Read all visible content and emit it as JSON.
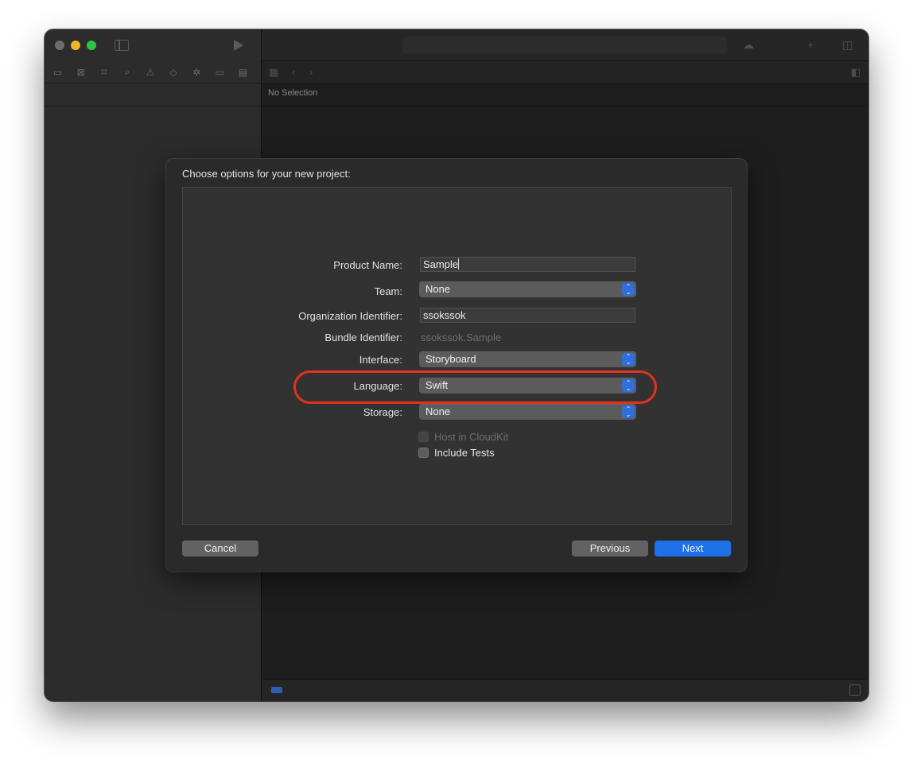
{
  "window": {
    "main": {
      "no_selection": "No Selection"
    }
  },
  "dialog": {
    "title": "Choose options for your new project:",
    "fields": {
      "product_name": {
        "label": "Product Name:",
        "value": "Sample"
      },
      "team": {
        "label": "Team:",
        "value": "None"
      },
      "organization_identifier": {
        "label": "Organization Identifier:",
        "value": "ssokssok"
      },
      "bundle_identifier": {
        "label": "Bundle Identifier:",
        "value": "ssokssok.Sample"
      },
      "interface": {
        "label": "Interface:",
        "value": "Storyboard"
      },
      "language": {
        "label": "Language:",
        "value": "Swift"
      },
      "storage": {
        "label": "Storage:",
        "value": "None"
      }
    },
    "checkboxes": {
      "host_in_cloudkit": {
        "label": "Host in CloudKit",
        "checked": false,
        "enabled": false
      },
      "include_tests": {
        "label": "Include Tests",
        "checked": false,
        "enabled": true
      }
    },
    "buttons": {
      "cancel": "Cancel",
      "previous": "Previous",
      "next": "Next"
    }
  },
  "colors": {
    "accent": "#1d71e8",
    "highlight_ring": "#e3321c"
  }
}
